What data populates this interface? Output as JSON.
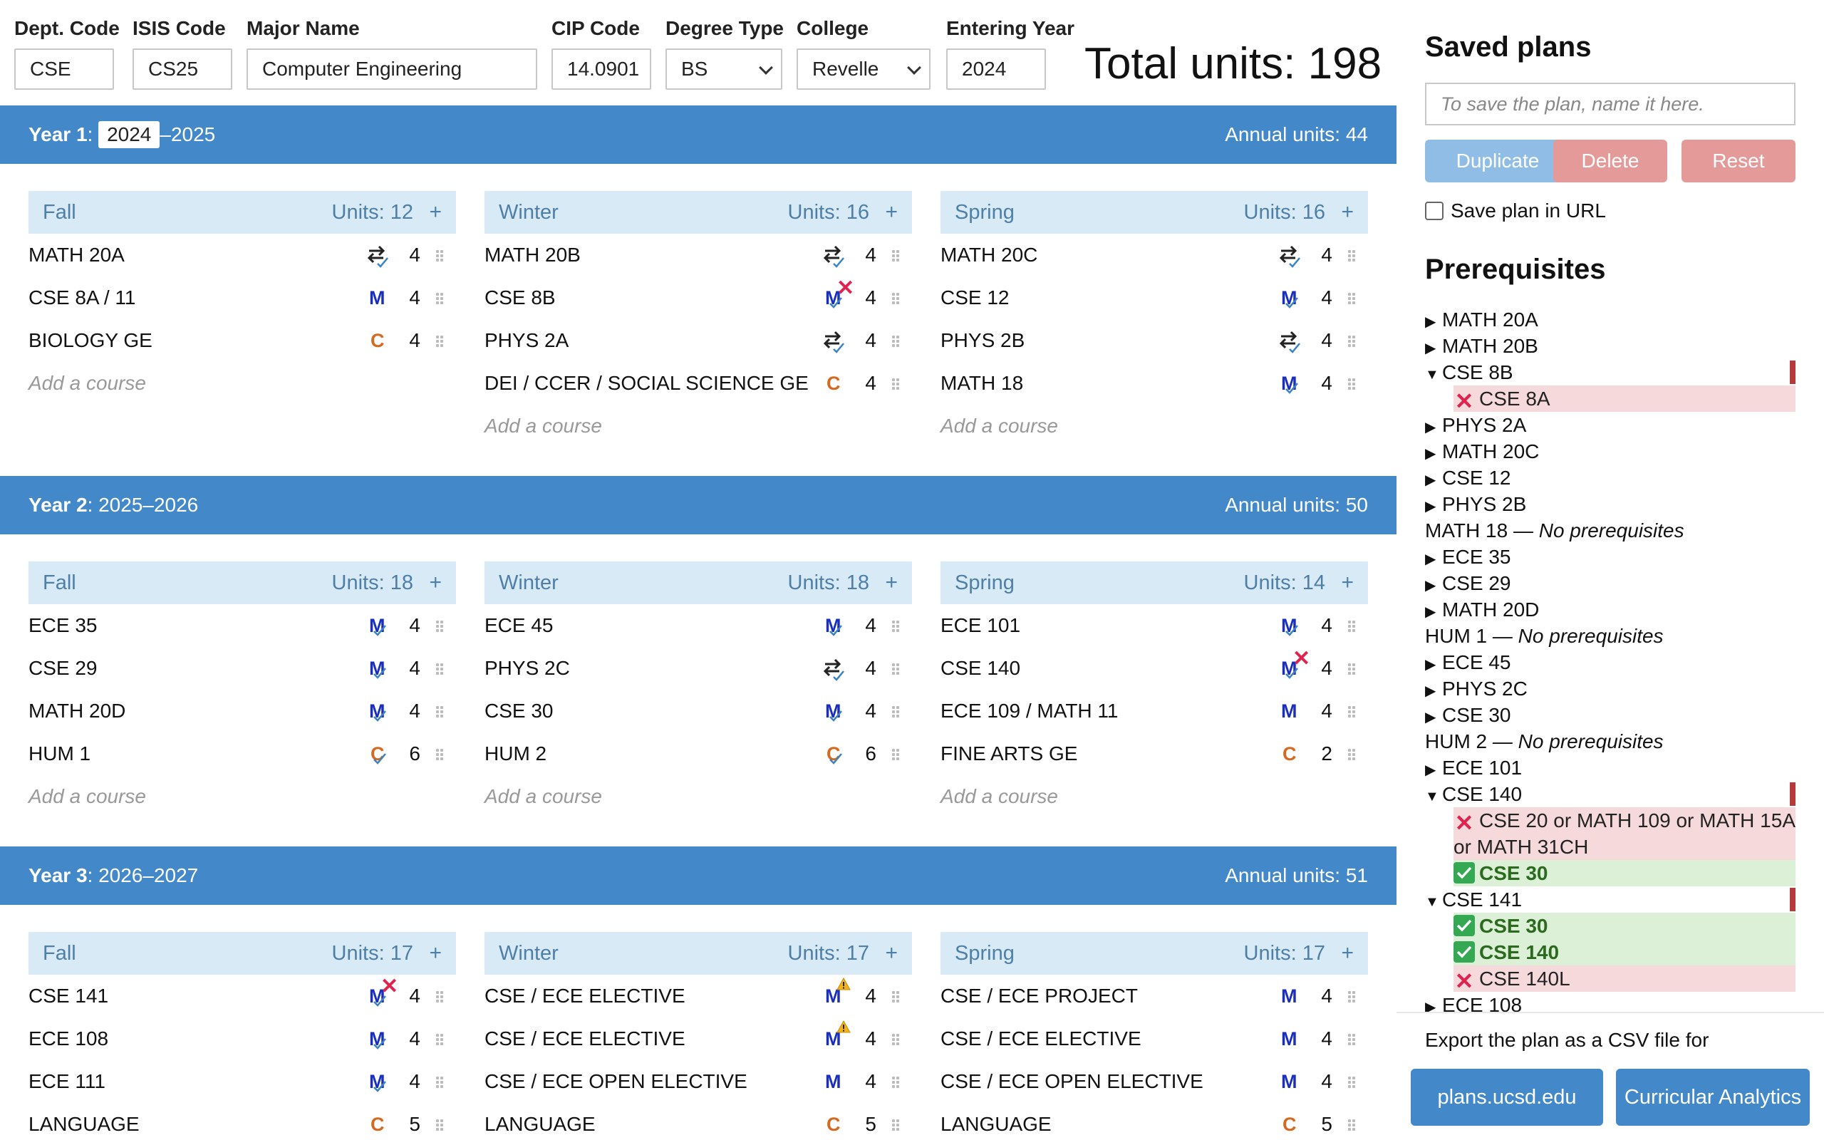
{
  "header": {
    "dept_label": "Dept. Code",
    "dept_value": "CSE",
    "isis_label": "ISIS Code",
    "isis_value": "CS25",
    "major_label": "Major Name",
    "major_value": "Computer Engineering",
    "cip_label": "CIP Code",
    "cip_value": "14.0901",
    "degree_label": "Degree Type",
    "degree_value": "BS",
    "college_label": "College",
    "college_value": "Revelle",
    "year_label": "Entering Year",
    "year_value": "2024",
    "total_units": "Total units: 198"
  },
  "years": [
    {
      "label": "Year 1",
      "sep": ": ",
      "start": "2024",
      "rest": "–2025",
      "annual": "Annual units: 44",
      "terms": [
        {
          "name": "Fall",
          "units": "Units: 12",
          "add": "+",
          "courses": [
            {
              "name": "MATH 20A",
              "units": "4",
              "badge": "swap"
            },
            {
              "name": "CSE 8A / 11",
              "units": "4",
              "badge": "m"
            },
            {
              "name": "BIOLOGY GE",
              "units": "4",
              "badge": "c"
            }
          ]
        },
        {
          "name": "Winter",
          "units": "Units: 16",
          "add": "+",
          "courses": [
            {
              "name": "MATH 20B",
              "units": "4",
              "badge": "swap"
            },
            {
              "name": "CSE 8B",
              "units": "4",
              "badge": "m-check-x"
            },
            {
              "name": "PHYS 2A",
              "units": "4",
              "badge": "swap"
            },
            {
              "name": "DEI / CCER / SOCIAL SCIENCE GE",
              "units": "4",
              "badge": "c"
            }
          ]
        },
        {
          "name": "Spring",
          "units": "Units: 16",
          "add": "+",
          "courses": [
            {
              "name": "MATH 20C",
              "units": "4",
              "badge": "swap"
            },
            {
              "name": "CSE 12",
              "units": "4",
              "badge": "m-check"
            },
            {
              "name": "PHYS 2B",
              "units": "4",
              "badge": "swap"
            },
            {
              "name": "MATH 18",
              "units": "4",
              "badge": "m-check"
            }
          ]
        }
      ]
    },
    {
      "label": "Year 2",
      "sep": ": ",
      "start": "2025–2026",
      "rest": "",
      "annual": "Annual units: 50",
      "terms": [
        {
          "name": "Fall",
          "units": "Units: 18",
          "add": "+",
          "courses": [
            {
              "name": "ECE 35",
              "units": "4",
              "badge": "m-check"
            },
            {
              "name": "CSE 29",
              "units": "4",
              "badge": "m-check"
            },
            {
              "name": "MATH 20D",
              "units": "4",
              "badge": "m-check"
            },
            {
              "name": "HUM 1",
              "units": "6",
              "badge": "c-check"
            }
          ]
        },
        {
          "name": "Winter",
          "units": "Units: 18",
          "add": "+",
          "courses": [
            {
              "name": "ECE 45",
              "units": "4",
              "badge": "m-check"
            },
            {
              "name": "PHYS 2C",
              "units": "4",
              "badge": "swap"
            },
            {
              "name": "CSE 30",
              "units": "4",
              "badge": "m-check"
            },
            {
              "name": "HUM 2",
              "units": "6",
              "badge": "c-check"
            }
          ]
        },
        {
          "name": "Spring",
          "units": "Units: 14",
          "add": "+",
          "courses": [
            {
              "name": "ECE 101",
              "units": "4",
              "badge": "m-check"
            },
            {
              "name": "CSE 140",
              "units": "4",
              "badge": "m-check-x"
            },
            {
              "name": "ECE 109 / MATH 11",
              "units": "4",
              "badge": "m"
            },
            {
              "name": "FINE ARTS GE",
              "units": "2",
              "badge": "c"
            }
          ]
        }
      ]
    },
    {
      "label": "Year 3",
      "sep": ": ",
      "start": "2026–2027",
      "rest": "",
      "annual": "Annual units: 51",
      "terms": [
        {
          "name": "Fall",
          "units": "Units: 17",
          "add": "+",
          "courses": [
            {
              "name": "CSE 141",
              "units": "4",
              "badge": "m-check-x"
            },
            {
              "name": "ECE 108",
              "units": "4",
              "badge": "m-check"
            },
            {
              "name": "ECE 111",
              "units": "4",
              "badge": "m-check"
            },
            {
              "name": "LANGUAGE",
              "units": "5",
              "badge": "c"
            }
          ]
        },
        {
          "name": "Winter",
          "units": "Units: 17",
          "add": "+",
          "courses": [
            {
              "name": "CSE / ECE ELECTIVE",
              "units": "4",
              "badge": "m-warn"
            },
            {
              "name": "CSE / ECE ELECTIVE",
              "units": "4",
              "badge": "m-warn"
            },
            {
              "name": "CSE / ECE OPEN ELECTIVE",
              "units": "4",
              "badge": "m"
            },
            {
              "name": "LANGUAGE",
              "units": "5",
              "badge": "c"
            }
          ]
        },
        {
          "name": "Spring",
          "units": "Units: 17",
          "add": "+",
          "courses": [
            {
              "name": "CSE / ECE PROJECT",
              "units": "4",
              "badge": "m"
            },
            {
              "name": "CSE / ECE ELECTIVE",
              "units": "4",
              "badge": "m"
            },
            {
              "name": "CSE / ECE OPEN ELECTIVE",
              "units": "4",
              "badge": "m"
            },
            {
              "name": "LANGUAGE",
              "units": "5",
              "badge": "c"
            }
          ]
        }
      ]
    }
  ],
  "add_course_placeholder": "Add a course",
  "badges": {
    "m": "M",
    "c": "C",
    "x": "✕"
  },
  "sidebar": {
    "saved_title": "Saved plans",
    "plan_placeholder": "To save the plan, name it here.",
    "duplicate": "Duplicate",
    "delete": "Delete",
    "reset": "Reset",
    "save_url": "Save plan in URL",
    "prereq_title": "Prerequisites",
    "prereqs": [
      {
        "type": "collapsed",
        "label": "MATH 20A"
      },
      {
        "type": "collapsed",
        "label": "MATH 20B"
      },
      {
        "type": "expanded",
        "label": "CSE 8B",
        "flag": true
      },
      {
        "type": "fail",
        "label": "CSE 8A"
      },
      {
        "type": "collapsed",
        "label": "PHYS 2A"
      },
      {
        "type": "collapsed",
        "label": "MATH 20C"
      },
      {
        "type": "collapsed",
        "label": "CSE 12"
      },
      {
        "type": "collapsed",
        "label": "PHYS 2B"
      },
      {
        "type": "none",
        "label": "MATH 18",
        "note": " — No prerequisites"
      },
      {
        "type": "collapsed",
        "label": "ECE 35"
      },
      {
        "type": "collapsed",
        "label": "CSE 29"
      },
      {
        "type": "collapsed",
        "label": "MATH 20D"
      },
      {
        "type": "none",
        "label": "HUM 1",
        "note": " — No prerequisites"
      },
      {
        "type": "collapsed",
        "label": "ECE 45"
      },
      {
        "type": "collapsed",
        "label": "PHYS 2C"
      },
      {
        "type": "collapsed",
        "label": "CSE 30"
      },
      {
        "type": "none",
        "label": "HUM 2",
        "note": " — No prerequisites"
      },
      {
        "type": "collapsed",
        "label": "ECE 101"
      },
      {
        "type": "expanded",
        "label": "CSE 140",
        "flag": true
      },
      {
        "type": "fail",
        "label": "CSE 20 or MATH 109 or MATH 15A",
        "cont": "or MATH 31CH"
      },
      {
        "type": "ok",
        "label": "CSE 30"
      },
      {
        "type": "expanded",
        "label": "CSE 141",
        "flag": true
      },
      {
        "type": "ok",
        "label": "CSE 30"
      },
      {
        "type": "ok",
        "label": "CSE 140"
      },
      {
        "type": "fail",
        "label": "CSE 140L"
      },
      {
        "type": "collapsed",
        "label": "ECE 108"
      }
    ],
    "export_label": "Export the plan as a CSV file for",
    "export_plans": "plans.ucsd.edu",
    "export_ca": "Curricular Analytics"
  },
  "colors": {
    "accent": "#4388c8",
    "term_header": "#d8eaf5",
    "m_badge": "#1b2fbf",
    "c_badge": "#d4691f",
    "error": "#e0234e",
    "ok": "#34a853"
  }
}
